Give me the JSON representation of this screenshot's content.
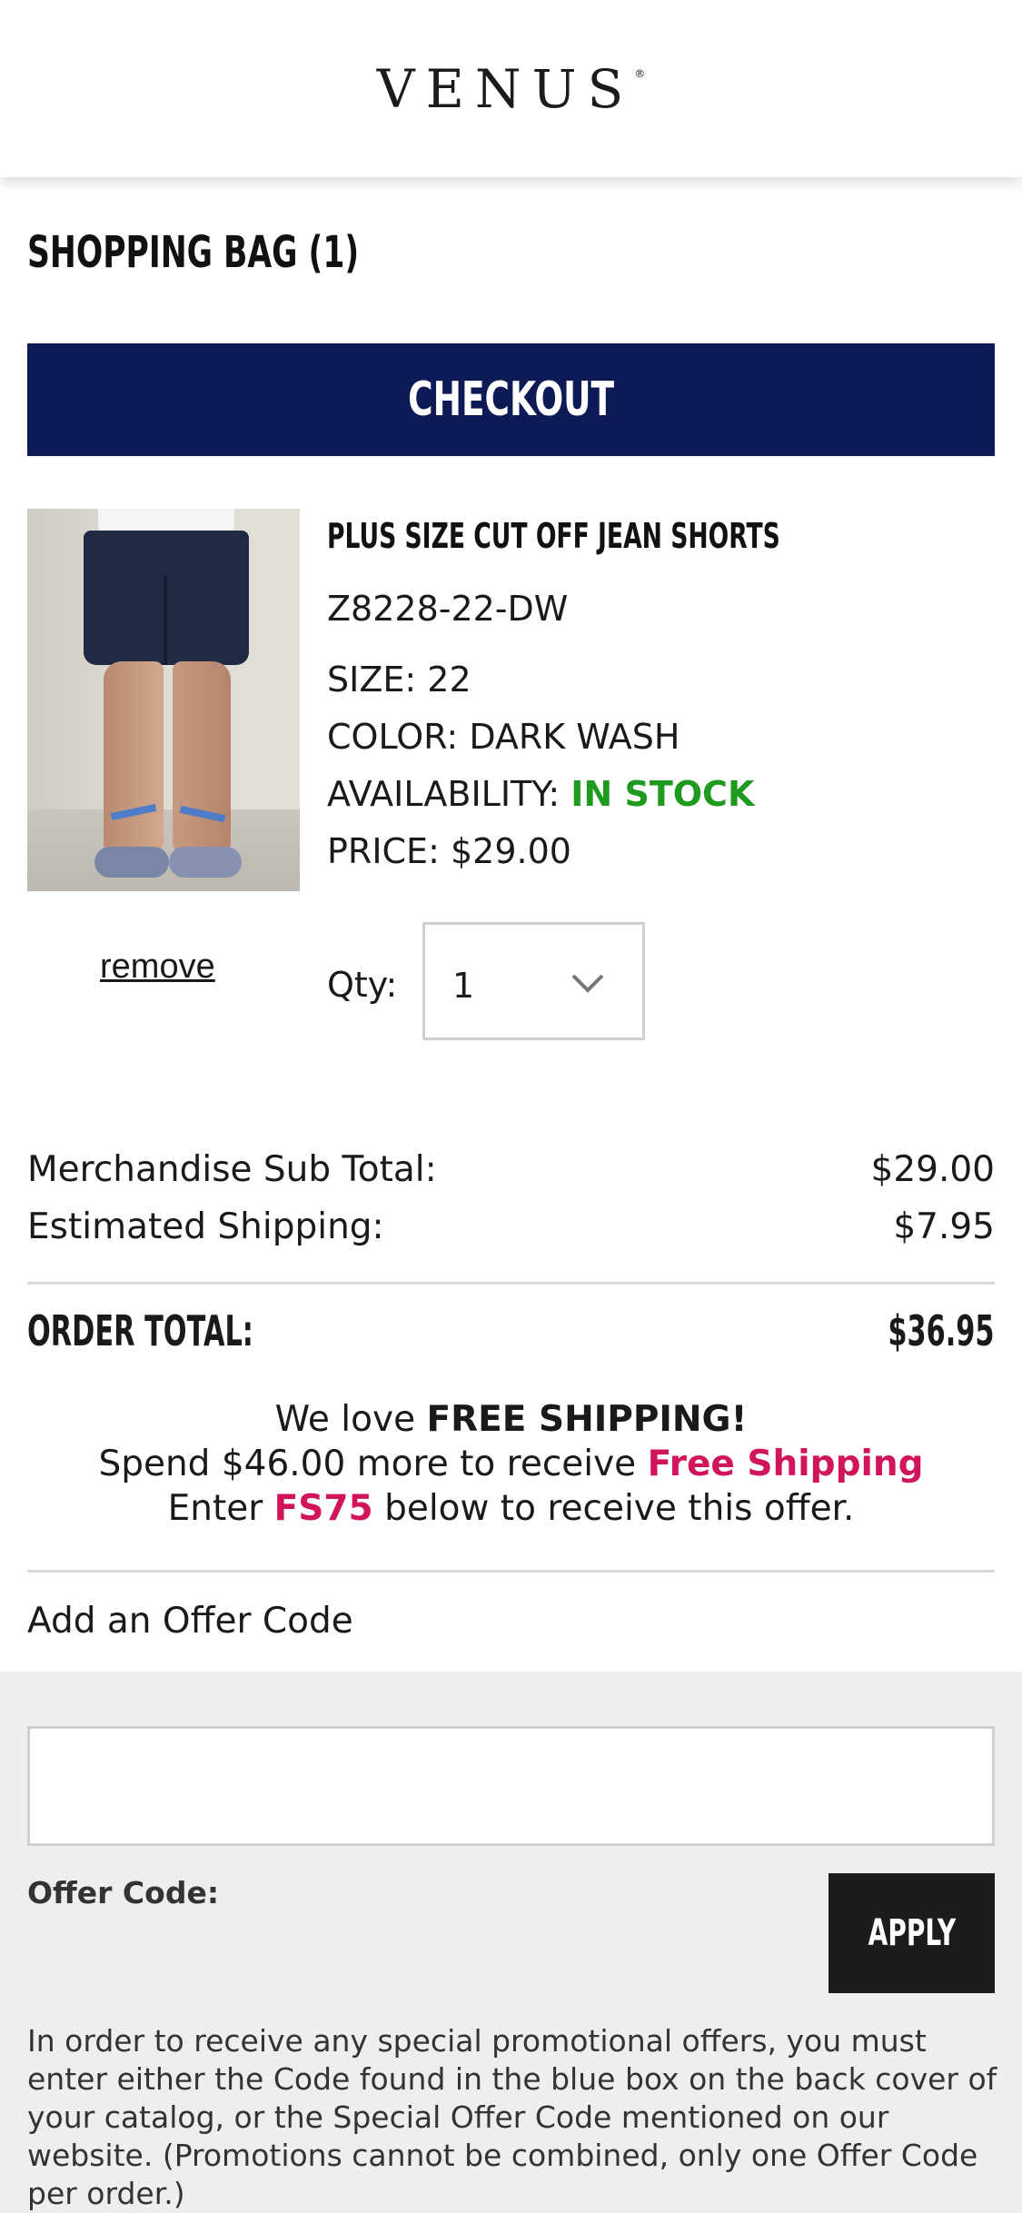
{
  "header": {
    "logo_text": "VENUS",
    "logo_mark": "®"
  },
  "bag": {
    "title": "SHOPPING BAG (1)",
    "checkout_label": "CHECKOUT"
  },
  "product": {
    "name": "PLUS SIZE CUT OFF JEAN SHORTS",
    "sku": "Z8228-22-DW",
    "size_label": "SIZE:",
    "size_value": "22",
    "color_label": "COLOR:",
    "color_value": "DARK WASH",
    "availability_label": "AVAILABILITY:",
    "availability_value": "IN STOCK",
    "price_label": "PRICE:",
    "price_value": "$29.00",
    "remove_label": "remove",
    "qty_label": "Qty:",
    "qty_value": "1"
  },
  "summary": {
    "subtotal_label": "Merchandise Sub Total:",
    "subtotal_value": "$29.00",
    "shipping_label": "Estimated Shipping:",
    "shipping_value": "$7.95",
    "total_label": "ORDER TOTAL:",
    "total_value": "$36.95"
  },
  "promo": {
    "line1_prefix": "We love ",
    "line1_bold": "FREE SHIPPING!",
    "line2_prefix": "Spend $46.00 more to receive ",
    "line2_highlight": "Free Shipping",
    "line3_prefix": "Enter ",
    "line3_code": "FS75",
    "line3_suffix": " below to receive this offer."
  },
  "offer": {
    "heading": "Add an Offer Code",
    "input_value": "",
    "field_label": "Offer Code:",
    "apply_label": "APPLY",
    "disclaimer": "In order to receive any special promotional offers, you must enter either the Code found in the blue box on the back cover of your catalog, or the Special Offer Code mentioned on our website. (Promotions cannot be combined, only one Offer Code per order.)"
  },
  "colors": {
    "navy": "#0d1a55",
    "in_stock": "#1e9a1e",
    "promo_pink": "#d0155d",
    "apply_bg": "#1c1c1c",
    "panel_bg": "#eeeeee"
  }
}
